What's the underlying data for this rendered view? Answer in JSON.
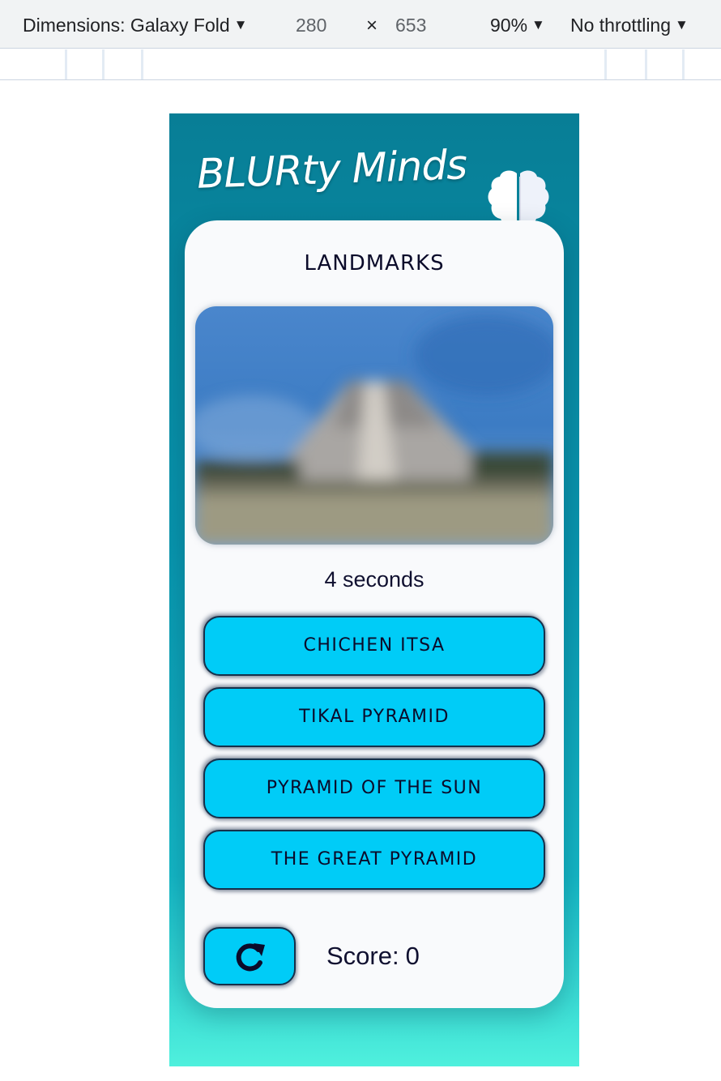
{
  "devtools": {
    "dimensions_label": "Dimensions: Galaxy Fold",
    "width": "280",
    "times": "×",
    "height": "653",
    "zoom": "90%",
    "throttling": "No throttling",
    "dropdown_icon": "triangle-down"
  },
  "app": {
    "title": "BLURty Minds",
    "logo_icon": "brain-icon",
    "category": "LANDMARKS",
    "photo_icon": "blurred-pyramid-photo",
    "timer": "4 seconds",
    "answers": [
      {
        "label": "CHICHEN ITSA"
      },
      {
        "label": "TIKAL PYRAMID"
      },
      {
        "label": "PYRAMID OF THE SUN"
      },
      {
        "label": "THE GREAT PYRAMID"
      }
    ],
    "restart_icon": "restart-icon",
    "score_label": "Score:",
    "score_value": "0"
  },
  "colors": {
    "header_gradient_top": "#087e96",
    "header_gradient_bottom": "#4ff0dd",
    "card": "#f9fafc",
    "button": "#00ccf7",
    "text": "#0b0b2a"
  }
}
